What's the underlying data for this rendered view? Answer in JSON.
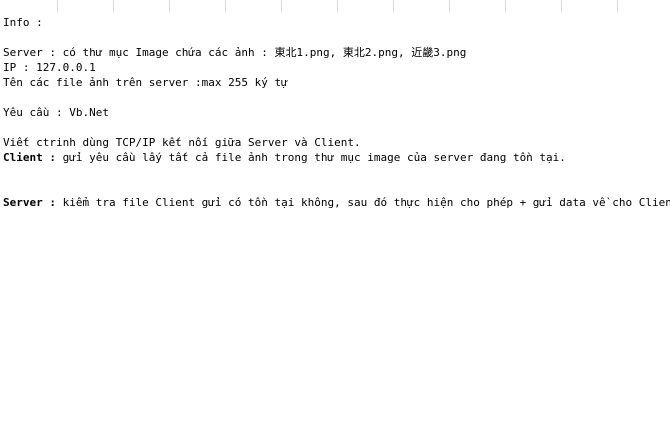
{
  "document": {
    "info_label": "Info :",
    "server_line": "Server : có thư mục Image chứa các ảnh : 東北1.png, 東北2.png, 近畿3.png",
    "ip_line": "IP : 127.0.0.1",
    "filename_line": "Tên các file ảnh trên server :max 255 ký tự",
    "requirement_line": "Yêu cầu : Vb.Net",
    "tcp_line": "Viết ctrinh dùng TCP/IP kết nối giữa Server và Client.",
    "client_label": "Client :",
    "client_text": " gửi yêu cầu lấy tất cả file ảnh trong thư mục image của server đang tồn tại.",
    "server_label": "Server :",
    "server_text": " kiểm tra file Client gửi có tồn tại không, sau đó thực hiện cho phép + gửi data về cho Client"
  }
}
